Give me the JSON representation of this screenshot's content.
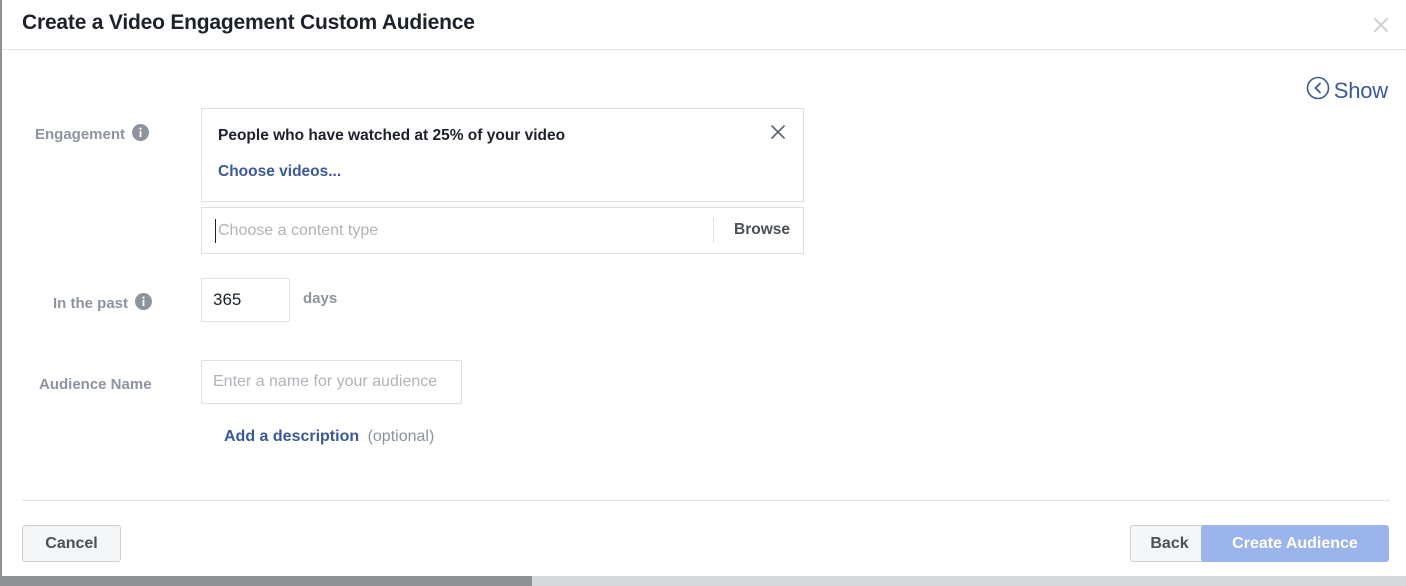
{
  "dialog": {
    "title": "Create a Video Engagement Custom Audience",
    "close_icon": "close-icon"
  },
  "show_toggle": {
    "label": "Show",
    "icon": "chevron-left-circle-icon"
  },
  "engagement": {
    "label": "Engagement",
    "info_icon": "info-icon",
    "rule_title": "People who have watched at 25% of your video",
    "choose_videos_label": "Choose videos...",
    "remove_icon": "close-icon",
    "content_type_placeholder": "Choose a content type",
    "browse_label": "Browse"
  },
  "in_the_past": {
    "label": "In the past",
    "info_icon": "info-icon",
    "days_value": "365",
    "days_suffix": "days"
  },
  "audience_name": {
    "label": "Audience Name",
    "placeholder": "Enter a name for your audience",
    "value": ""
  },
  "description": {
    "link_label": "Add a description",
    "optional_label": "(optional)"
  },
  "footer": {
    "cancel_label": "Cancel",
    "back_label": "Back",
    "create_label": "Create Audience"
  },
  "colors": {
    "link_blue": "#3b5998",
    "primary_disabled": "#9cb4ec",
    "label_gray": "#8d949e",
    "border_gray": "#dddfe2",
    "text_dark": "#1d2129"
  }
}
